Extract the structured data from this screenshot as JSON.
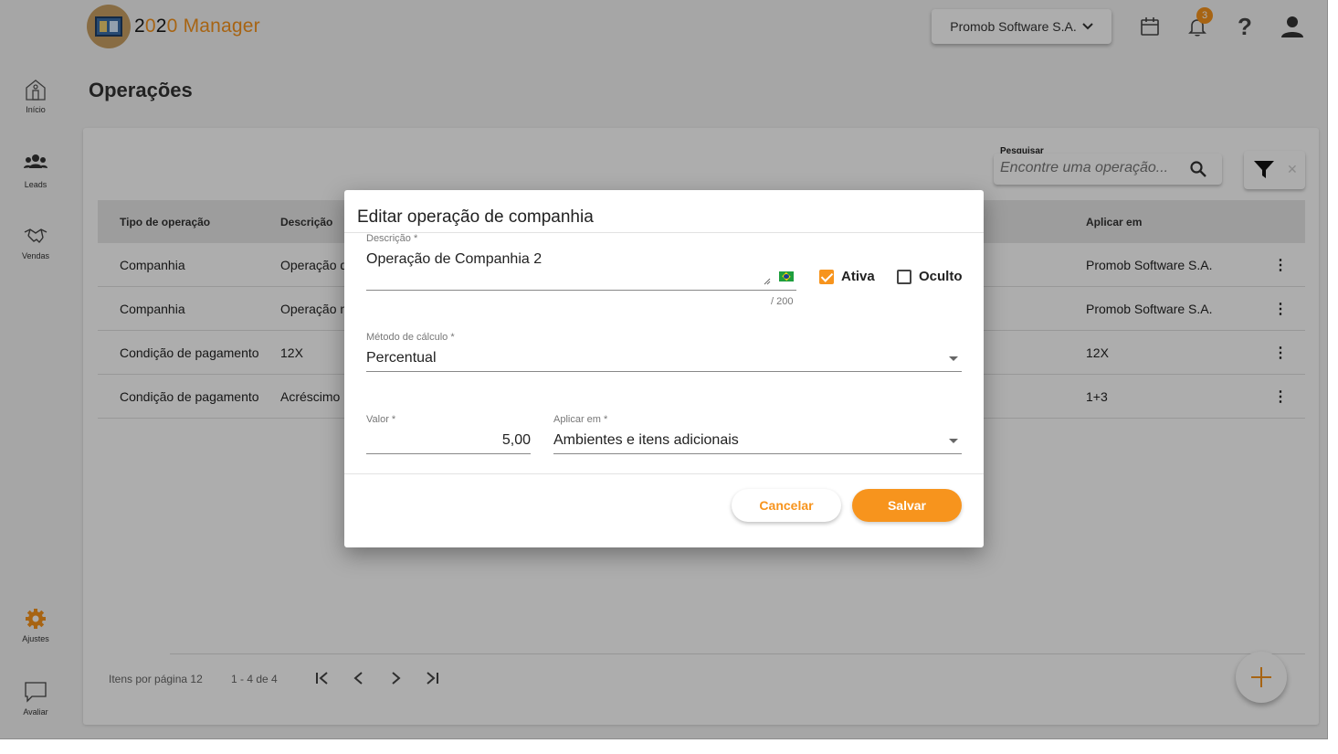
{
  "app": {
    "logo_number_prefix": "2",
    "logo_number_o": "0",
    "logo_number_rest": "2",
    "logo_number_o2": "0",
    "logo_name": " Manager",
    "company": "Promob Software S.A.",
    "notifications_count": "3"
  },
  "sidebar": {
    "items": [
      {
        "label": "Início",
        "icon": "home-icon"
      },
      {
        "label": "Leads",
        "icon": "people-icon"
      },
      {
        "label": "Vendas",
        "icon": "handshake-icon"
      },
      {
        "label": "Ajustes",
        "icon": "gear-icon"
      },
      {
        "label": "Avaliar",
        "icon": "comment-icon"
      }
    ]
  },
  "page": {
    "title": "Operações"
  },
  "search": {
    "label": "Pesquisar",
    "placeholder": "Encontre uma operação..."
  },
  "table": {
    "headers": [
      "Tipo de operação",
      "Descrição",
      "Aplicar em"
    ],
    "rows": [
      {
        "tipo": "Companhia",
        "descricao": "Operação d",
        "aplicar": "Promob Software S.A."
      },
      {
        "tipo": "Companhia",
        "descricao": "Operação n",
        "aplicar": "Promob Software S.A."
      },
      {
        "tipo": "Condição de pagamento",
        "descricao": "12X",
        "aplicar": "12X"
      },
      {
        "tipo": "Condição de pagamento",
        "descricao": "Acréscimo",
        "aplicar": "1+3"
      }
    ],
    "row_menu": "⋮"
  },
  "pager": {
    "per_page_label": "Itens por página 12",
    "range": "1 - 4 de 4"
  },
  "modal": {
    "title": "Editar operação de companhia",
    "descricao_label": "Descrição *",
    "descricao_value": "Operação de Companhia 2",
    "counter": "/ 200",
    "ativa_label": "Ativa",
    "ativa_checked": true,
    "oculto_label": "Oculto",
    "oculto_checked": false,
    "metodo_label": "Método de cálculo *",
    "metodo_value": "Percentual",
    "valor_label": "Valor *",
    "valor_value": "5,00",
    "aplicar_label": "Aplicar em *",
    "aplicar_value": "Ambientes e itens adicionais",
    "cancel_label": "Cancelar",
    "save_label": "Salvar"
  },
  "colors": {
    "accent": "#f7941d",
    "overlay": "rgba(0,0,0,0.32)"
  }
}
